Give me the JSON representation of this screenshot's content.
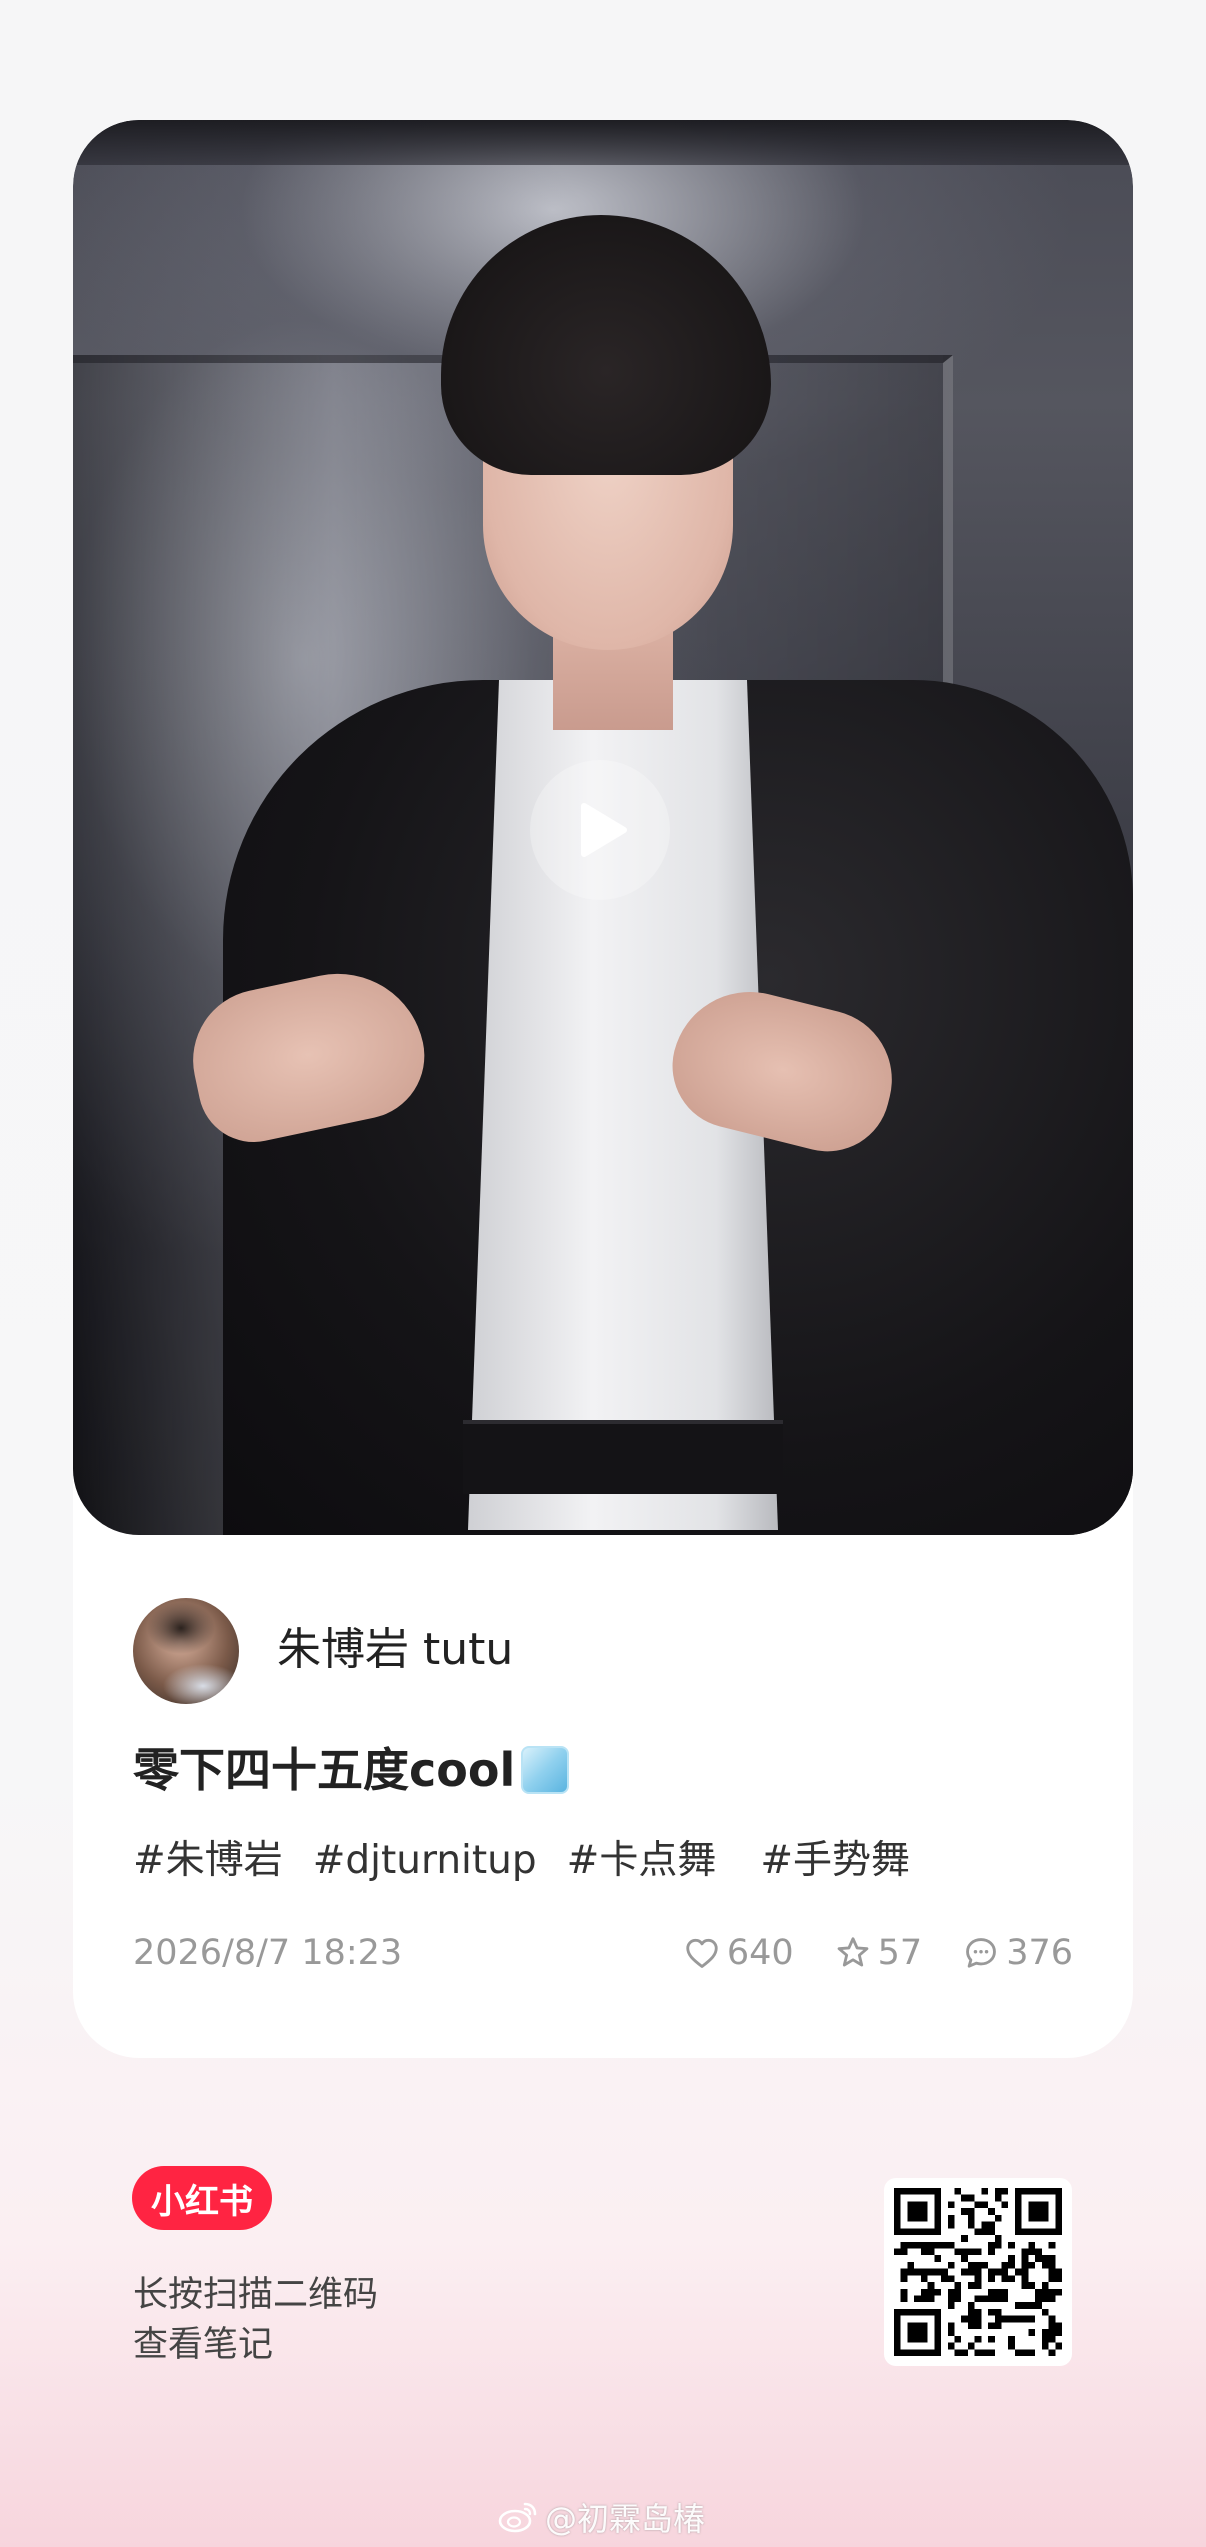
{
  "post": {
    "author_name": "朱博岩 tutu",
    "title": "零下四十五度cool",
    "title_emoji_icon": "ice-cube-icon",
    "tags": [
      "#朱博岩",
      "#djturnitup",
      "#卡点舞",
      "#手势舞"
    ],
    "date": "2026/8/7 18:23",
    "stats": {
      "likes": "640",
      "favorites": "57",
      "comments": "376"
    },
    "media_control": "play-icon"
  },
  "footer": {
    "brand": "小红书",
    "scan_hint_line1": "长按扫描二维码",
    "scan_hint_line2": "查看笔记"
  },
  "watermark": {
    "text": "@初霖岛椿",
    "icon": "weibo-icon"
  },
  "colors": {
    "brand_red": "#ff2442",
    "meta_gray": "#999999"
  }
}
